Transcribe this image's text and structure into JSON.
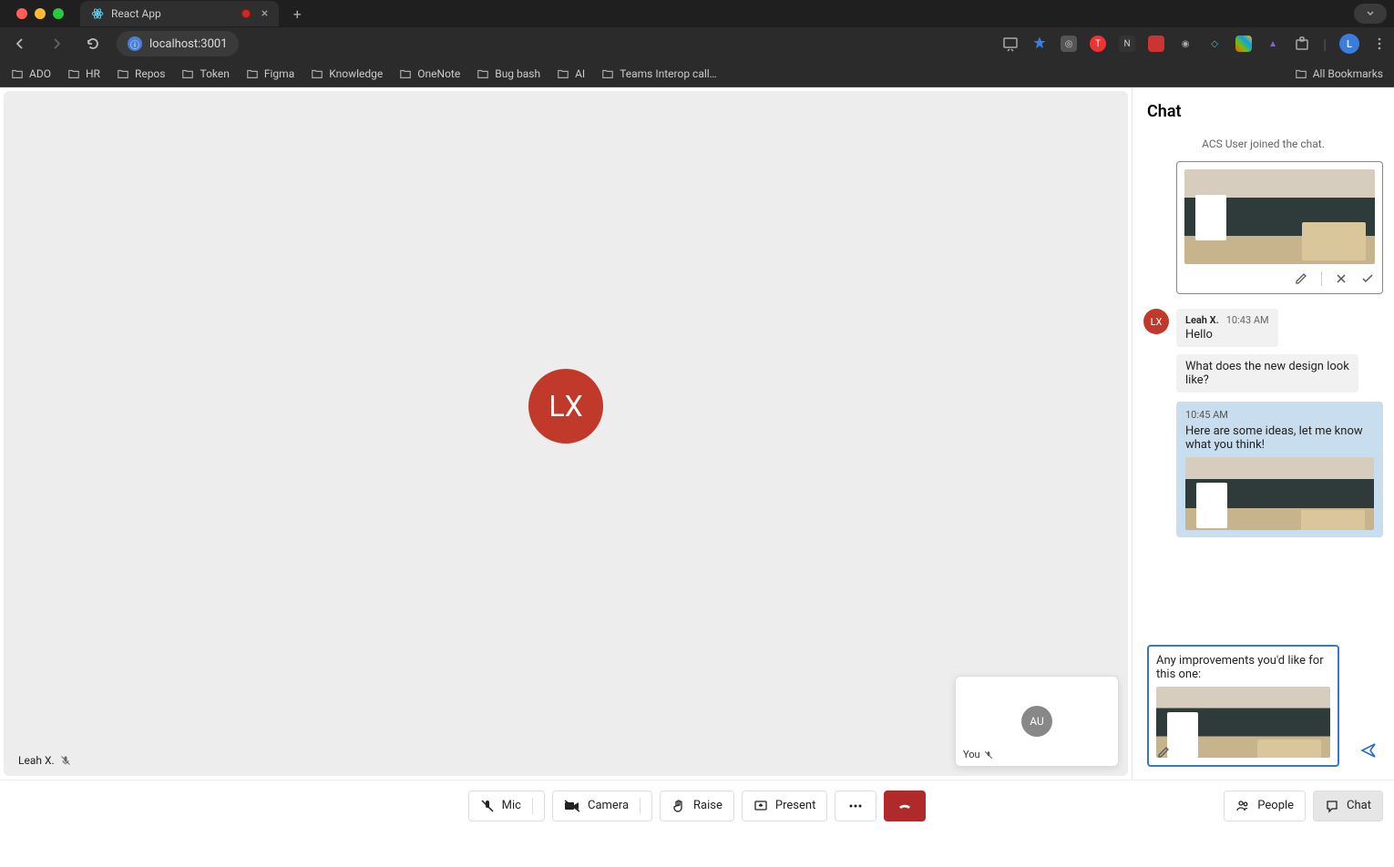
{
  "browser": {
    "tab_title": "React App",
    "url": "localhost:3001",
    "bookmarks": [
      "ADO",
      "HR",
      "Repos",
      "Token",
      "Figma",
      "Knowledge",
      "OneNote",
      "Bug bash",
      "AI",
      "Teams Interop call…"
    ],
    "all_bookmarks": "All Bookmarks",
    "profile_initial": "L"
  },
  "call": {
    "main_initials": "LX",
    "main_name": "Leah X.",
    "pip_initials": "AU",
    "pip_label": "You"
  },
  "chat": {
    "title": "Chat",
    "system_msg": "ACS User joined the chat.",
    "msg1": {
      "avatar": "LX",
      "name": "Leah X.",
      "time": "10:43 AM",
      "text": "Hello"
    },
    "msg2": {
      "text": "What does the new design look like?"
    },
    "msg3": {
      "time": "10:45 AM",
      "text": "Here are some ideas, let me know what you think!"
    },
    "compose_text": "Any improvements you'd like for this one:"
  },
  "controls": {
    "mic": "Mic",
    "camera": "Camera",
    "raise": "Raise",
    "present": "Present",
    "people": "People",
    "chat": "Chat"
  }
}
